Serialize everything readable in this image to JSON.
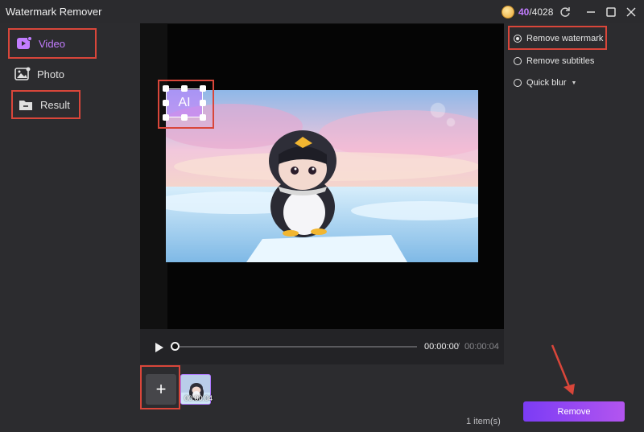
{
  "app": {
    "title": "Watermark Remover"
  },
  "credits": {
    "used": "40",
    "separator": "/",
    "total": "4028"
  },
  "sidebar": {
    "items": [
      {
        "label": "Video",
        "icon": "video-icon",
        "active": true
      },
      {
        "label": "Photo",
        "icon": "photo-icon"
      },
      {
        "label": "Result",
        "icon": "folder-icon"
      }
    ]
  },
  "preview": {
    "watermark_text": "AI"
  },
  "player": {
    "current_time": "00:00:00",
    "separator": "/",
    "total_time": "00:00:04",
    "progress": 0
  },
  "media": {
    "add_label": "+",
    "thumbnail_duration": "00:00:04",
    "item_count": "1 item(s)"
  },
  "options": [
    {
      "label": "Remove watermark",
      "selected": true
    },
    {
      "label": "Remove subtitles",
      "selected": false
    },
    {
      "label": "Quick blur",
      "selected": false,
      "has_dropdown": true
    }
  ],
  "actions": {
    "remove_label": "Remove"
  },
  "colors": {
    "accent": "#c27dff",
    "highlight": "#d9463a",
    "button_start": "#7b3cf5",
    "button_end": "#b355ef"
  }
}
